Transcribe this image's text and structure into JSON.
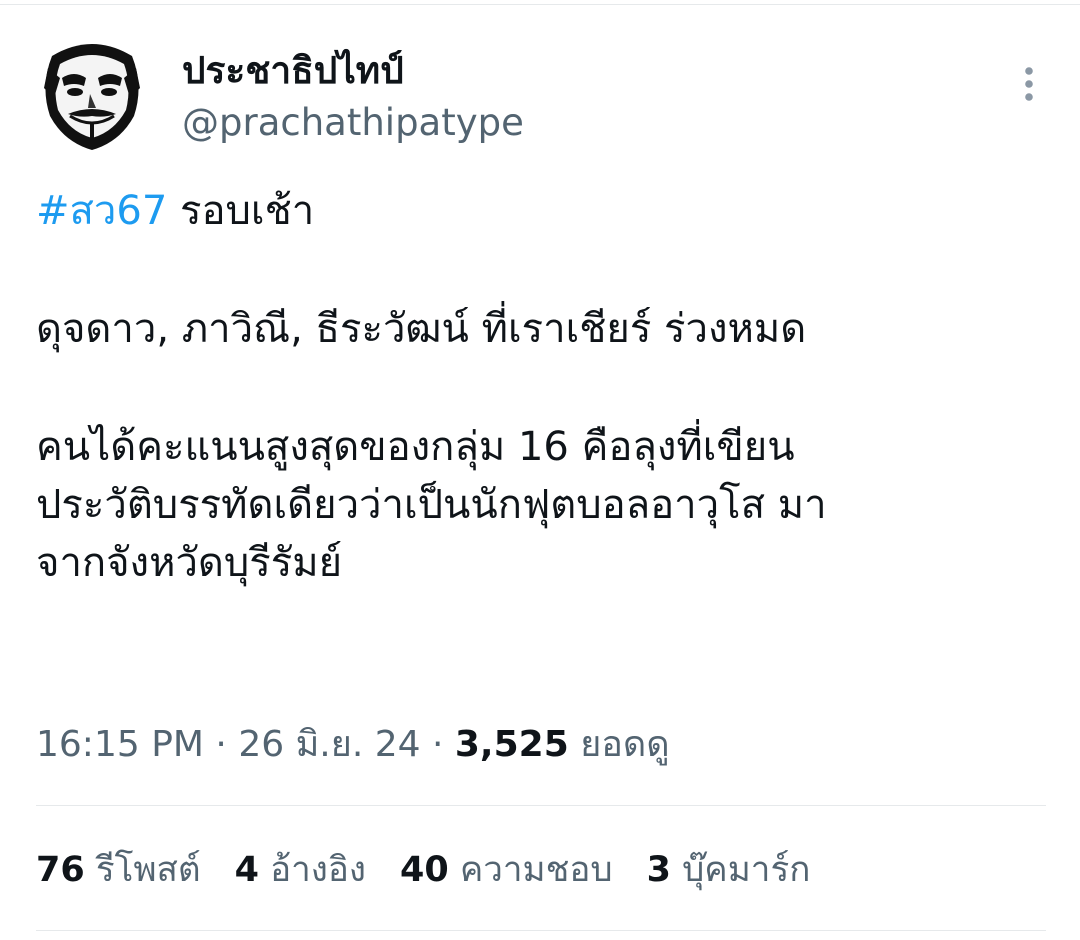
{
  "author": {
    "display_name": "ประชาธิปไทป์",
    "handle": "@prachathipatype",
    "avatar_icon": "guy-fawkes-mask-icon"
  },
  "tweet": {
    "hashtag": "#สว67",
    "line1_rest": " รอบเช้า",
    "line2": "ดุจดาว, ภาวิณี, ธีระวัฒน์ ที่เราเชียร์ ร่วงหมด",
    "line3": "คนได้คะแนนสูงสุดของกลุ่ม 16 คือลุงที่เขียน",
    "line4": "ประวัติบรรทัดเดียวว่าเป็นนักฟุตบอลอาวุโส มา",
    "line5": "จากจังหวัดบุรีรัมย์"
  },
  "meta": {
    "time": "16:15 PM",
    "sep1": " · ",
    "date": "26 มิ.ย. 24",
    "sep2": " · ",
    "views_count": "3,525",
    "views_label": " ยอดดู"
  },
  "stats": {
    "reposts_count": "76",
    "reposts_label": " รีโพสต์",
    "quotes_count": "4",
    "quotes_label": " อ้างอิง",
    "likes_count": "40",
    "likes_label": " ความชอบ",
    "bookmarks_count": "3",
    "bookmarks_label": " บุ๊คมาร์ก"
  },
  "colors": {
    "link": "#1d9bf0",
    "secondary_text": "#536471",
    "primary_text": "#0f1419"
  }
}
